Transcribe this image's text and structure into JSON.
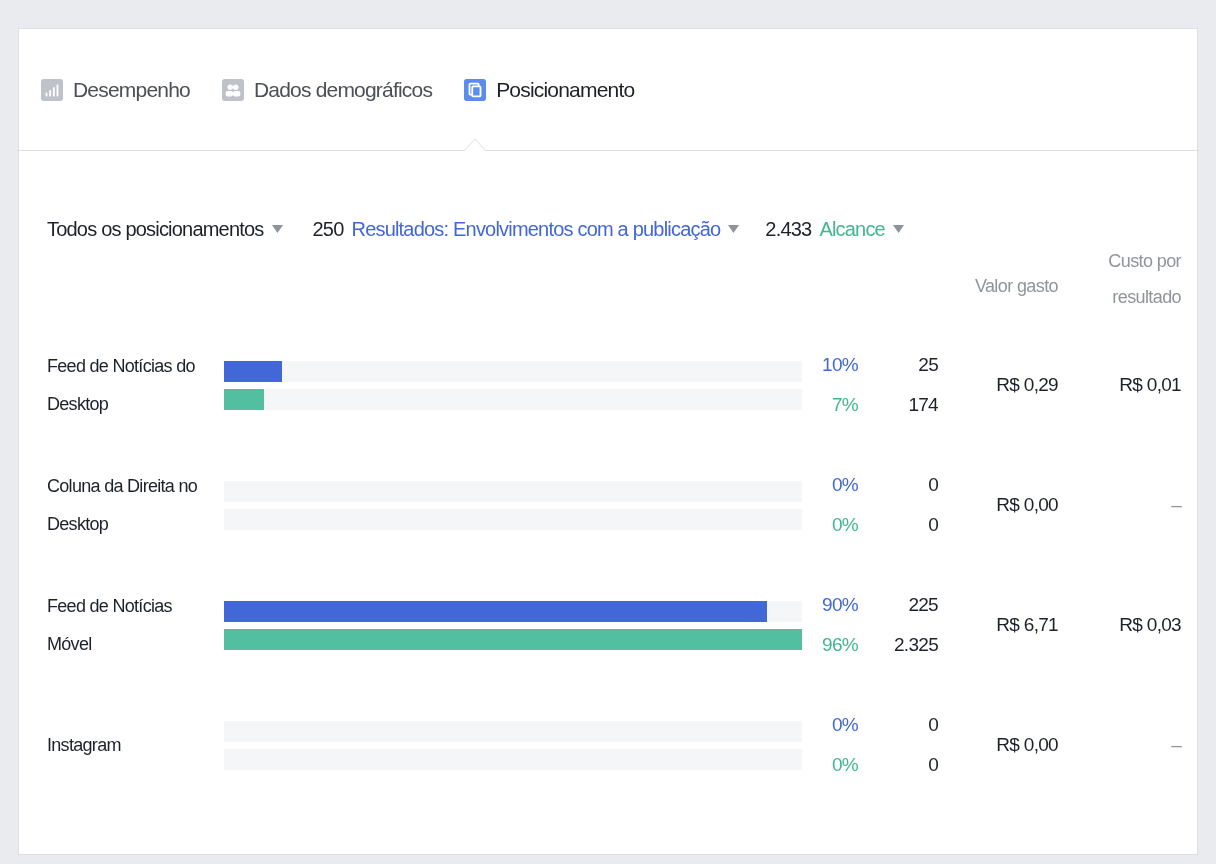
{
  "tabs": [
    {
      "label": "Desempenho",
      "selected": false
    },
    {
      "label": "Dados demográficos",
      "selected": false
    },
    {
      "label": "Posicionamento",
      "selected": true
    }
  ],
  "filters": {
    "placement": {
      "label": "Todos os posicionamentos"
    },
    "results": {
      "count": "250",
      "label": "Resultados: Envolvimentos com a publicação"
    },
    "reach": {
      "count": "2.433",
      "label": "Alcance"
    }
  },
  "columns": {
    "spent": "Valor gasto",
    "cost": "Custo por resultado"
  },
  "rows": [
    {
      "name": "Feed de Notícias do Desktop",
      "results": {
        "level": 0.1,
        "percent": "10%",
        "count": "25"
      },
      "reach": {
        "level": 0.07,
        "percent": "7%",
        "count": "174"
      },
      "spent": "R$ 0,29",
      "cost": "R$ 0,01"
    },
    {
      "name": "Coluna da Direita no Desktop",
      "results": {
        "level": 0,
        "percent": "0%",
        "count": "0"
      },
      "reach": {
        "level": 0,
        "percent": "0%",
        "count": "0"
      },
      "spent": "R$ 0,00",
      "cost": "–"
    },
    {
      "name": "Feed de Notícias Móvel",
      "results": {
        "level": 0.94,
        "percent": "90%",
        "count": "225"
      },
      "reach": {
        "level": 1,
        "percent": "96%",
        "count": "2.325"
      },
      "spent": "R$ 6,71",
      "cost": "R$ 0,03"
    },
    {
      "name": "Instagram",
      "results": {
        "level": 0,
        "percent": "0%",
        "count": "0"
      },
      "reach": {
        "level": 0,
        "percent": "0%",
        "count": "0"
      },
      "spent": "R$ 0,00",
      "cost": "–"
    }
  ]
}
